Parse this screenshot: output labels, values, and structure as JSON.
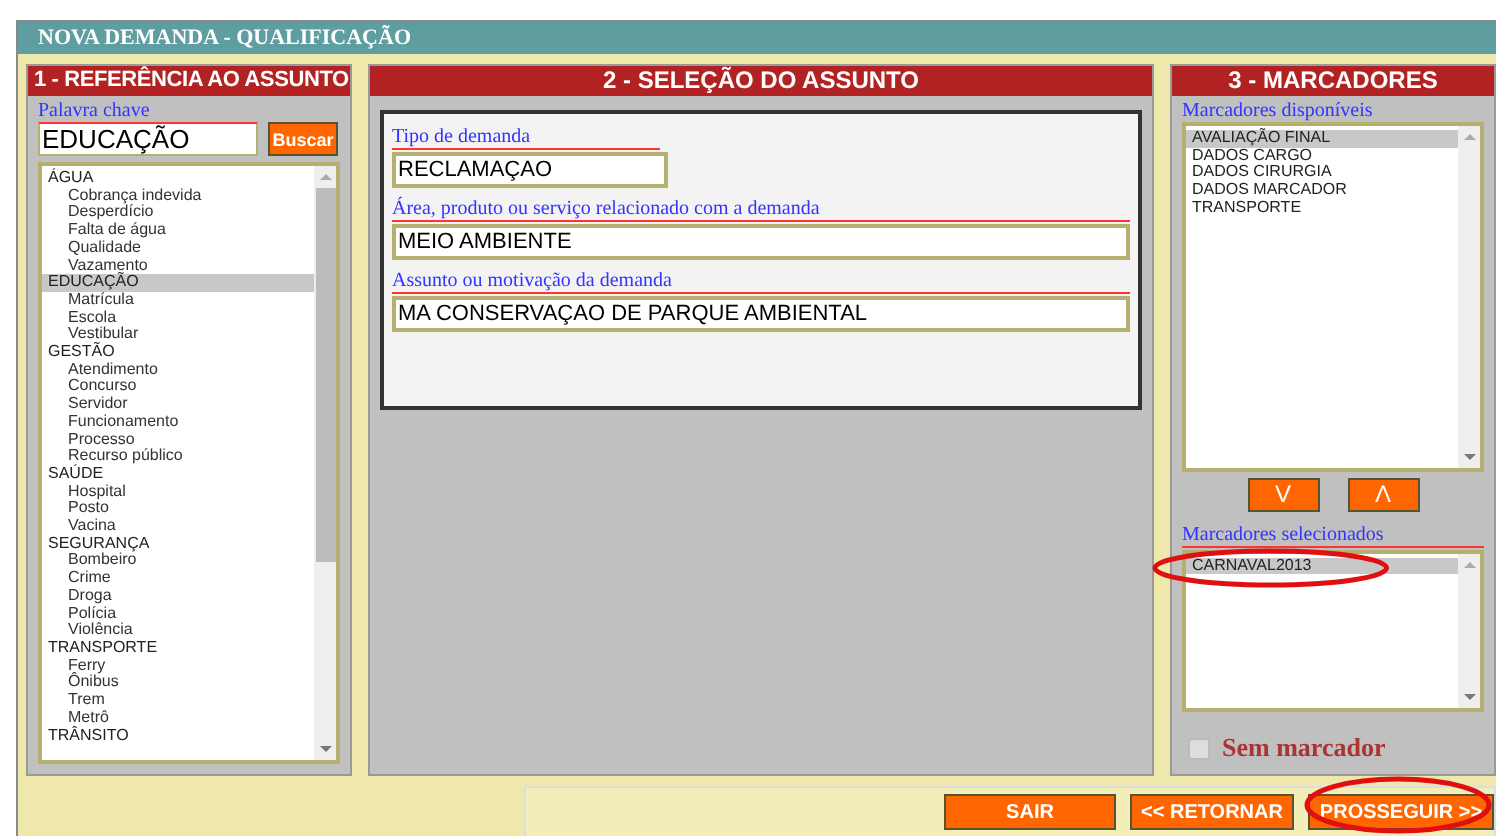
{
  "window": {
    "title": "NOVA DEMANDA - QUALIFICAÇÃO"
  },
  "reference_panel": {
    "title": "1 - REFERÊNCIA AO ASSUNTO",
    "keyword": {
      "label": "Palavra chave",
      "value": "EDUCAÇÃO"
    },
    "search_button": "Buscar",
    "topics": [
      {
        "label": "ÁGUA",
        "selected": false,
        "children": [
          {
            "label": "Cobrança indevida",
            "selected": false
          },
          {
            "label": "Desperdício",
            "selected": false
          },
          {
            "label": "Falta de água",
            "selected": false
          },
          {
            "label": "Qualidade",
            "selected": false
          },
          {
            "label": "Vazamento",
            "selected": false
          }
        ]
      },
      {
        "label": "EDUCAÇÃO",
        "selected": true,
        "children": [
          {
            "label": "Matrícula",
            "selected": false
          },
          {
            "label": "Escola",
            "selected": false
          },
          {
            "label": "Vestibular",
            "selected": false
          }
        ]
      },
      {
        "label": "GESTÃO",
        "selected": false,
        "children": [
          {
            "label": "Atendimento",
            "selected": false
          },
          {
            "label": "Concurso",
            "selected": false
          },
          {
            "label": "Servidor",
            "selected": false
          },
          {
            "label": "Funcionamento",
            "selected": false
          },
          {
            "label": "Processo",
            "selected": false
          },
          {
            "label": "Recurso público",
            "selected": false
          }
        ]
      },
      {
        "label": "SAÚDE",
        "selected": false,
        "children": [
          {
            "label": "Hospital",
            "selected": false
          },
          {
            "label": "Posto",
            "selected": false
          },
          {
            "label": "Vacina",
            "selected": false
          }
        ]
      },
      {
        "label": "SEGURANÇA",
        "selected": false,
        "children": [
          {
            "label": "Bombeiro",
            "selected": false
          },
          {
            "label": "Crime",
            "selected": false
          },
          {
            "label": "Droga",
            "selected": false
          },
          {
            "label": "Polícia",
            "selected": false
          },
          {
            "label": "Violência",
            "selected": false
          }
        ]
      },
      {
        "label": "TRANSPORTE",
        "selected": false,
        "children": [
          {
            "label": "Ferry",
            "selected": false
          },
          {
            "label": "Ônibus",
            "selected": false
          },
          {
            "label": "Trem",
            "selected": false
          },
          {
            "label": "Metrô",
            "selected": false
          }
        ]
      },
      {
        "label": "TRÂNSITO",
        "selected": false
      }
    ]
  },
  "subject_panel": {
    "title": "2 - SELEÇÃO DO ASSUNTO",
    "fields": [
      {
        "label": "Tipo de demanda",
        "value": "RECLAMAÇAO",
        "kind": "short"
      },
      {
        "label": "Área, produto ou serviço relacionado com a demanda",
        "value": "MEIO AMBIENTE",
        "kind": "wide"
      },
      {
        "label": "Assunto ou motivação da demanda",
        "value": "MA CONSERVAÇAO DE PARQUE AMBIENTAL",
        "kind": "wide"
      }
    ]
  },
  "markers_panel": {
    "title": "3 - MARCADORES",
    "available_label": "Marcadores disponíveis",
    "available": [
      {
        "label": "AVALIAÇÃO FINAL",
        "selected": true
      },
      {
        "label": "DADOS CARGO",
        "selected": false
      },
      {
        "label": "DADOS CIRURGIA",
        "selected": false
      },
      {
        "label": "DADOS MARCADOR",
        "selected": false
      },
      {
        "label": "TRANSPORTE",
        "selected": false
      }
    ],
    "move_down_button": "V",
    "move_up_button": "Λ",
    "selected_label": "Marcadores selecionados",
    "selected_markers": [
      {
        "label": "CARNAVAL2013",
        "selected": true,
        "highlighted": true
      }
    ],
    "no_marker": {
      "label": "Sem marcador",
      "checked": false
    }
  },
  "actions": [
    {
      "label": "SAIR",
      "highlighted": false
    },
    {
      "label": "<< RETORNAR",
      "highlighted": false
    },
    {
      "label": "PROSSEGUIR >>",
      "highlighted": true
    }
  ]
}
